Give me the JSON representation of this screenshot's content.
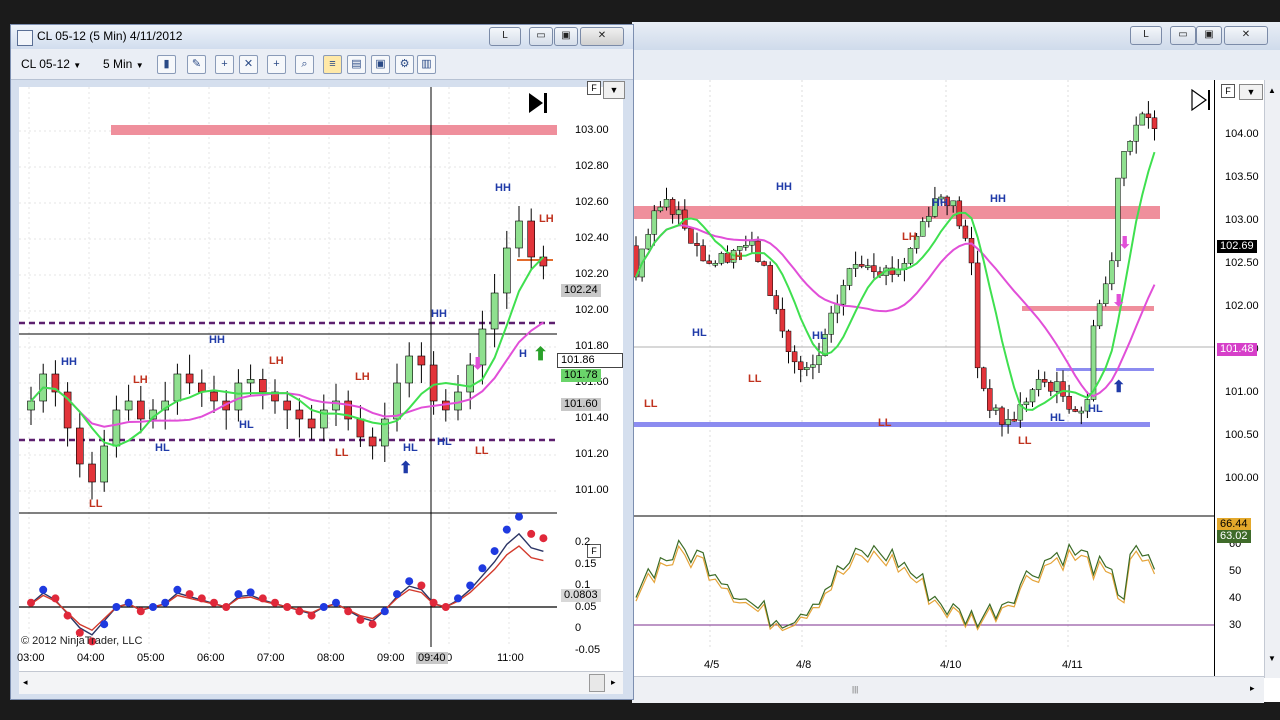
{
  "front_window": {
    "title": "CL 05-12 (5 Min)  4/11/2012",
    "toolbar": {
      "instrument": "CL 05-12",
      "interval": "5 Min"
    },
    "price_axis": [
      "103.00",
      "102.80",
      "102.60",
      "102.40",
      "102.20",
      "102.00",
      "101.80",
      "101.60",
      "101.40",
      "101.20",
      "101.00"
    ],
    "price_tags": {
      "last": "102.24",
      "line": "101.86",
      "green": "101.78",
      "grey": "101.60"
    },
    "indicator_axis": [
      "0.2",
      "0.15",
      "0.1",
      "0.05",
      "0",
      "-0.05"
    ],
    "indicator_value": "0.0803",
    "time_axis": [
      "03:00",
      "04:00",
      "05:00",
      "06:00",
      "07:00",
      "08:00",
      "09:00",
      ":00",
      "11:00"
    ],
    "cursor_time": "09:40",
    "copyright": "© 2012 NinjaTrader, LLC",
    "panel_button": "F",
    "swing_labels": [
      {
        "text": "HH",
        "color": "blue"
      },
      {
        "text": "LH",
        "color": "red"
      },
      {
        "text": "HH",
        "color": "blue"
      },
      {
        "text": "LH",
        "color": "red"
      },
      {
        "text": "LH",
        "color": "red"
      },
      {
        "text": "HH",
        "color": "blue"
      },
      {
        "text": "HH",
        "color": "blue"
      },
      {
        "text": "LH",
        "color": "red"
      },
      {
        "text": "HL",
        "color": "blue"
      },
      {
        "text": "HL",
        "color": "blue"
      },
      {
        "text": "HL",
        "color": "blue"
      },
      {
        "text": "LL",
        "color": "red"
      },
      {
        "text": "LL",
        "color": "red"
      },
      {
        "text": "LL",
        "color": "red"
      },
      {
        "text": "HL",
        "color": "blue"
      },
      {
        "text": "H",
        "color": "blue"
      }
    ]
  },
  "back_window": {
    "price_axis": [
      "104.00",
      "103.50",
      "103.00",
      "102.50",
      "102.00",
      "101.50",
      "101.00",
      "100.50",
      "100.00"
    ],
    "price_tags": {
      "last": "102.69",
      "ma": "101.48"
    },
    "indicator_axis": [
      "60",
      "50",
      "40",
      "30"
    ],
    "indicator_tags": {
      "a": "66.44",
      "b": "63.02"
    },
    "date_axis": [
      "4/5",
      "4/8",
      "4/10",
      "4/11"
    ],
    "panel_button": "F",
    "swing_labels": [
      {
        "text": "HH",
        "color": "blue"
      },
      {
        "text": "HH",
        "color": "blue"
      },
      {
        "text": "HH",
        "color": "blue"
      },
      {
        "text": "LH",
        "color": "red"
      },
      {
        "text": "LH",
        "color": "red"
      },
      {
        "text": "HL",
        "color": "blue"
      },
      {
        "text": "HL",
        "color": "blue"
      },
      {
        "text": "HL",
        "color": "blue"
      },
      {
        "text": "HL",
        "color": "blue"
      },
      {
        "text": "LL",
        "color": "red"
      },
      {
        "text": "LL",
        "color": "red"
      },
      {
        "text": "LL",
        "color": "red"
      },
      {
        "text": "LL",
        "color": "red"
      }
    ]
  },
  "window_buttons": {
    "restore": "L",
    "minimize": "▭",
    "maximize": "▣",
    "close": "✕"
  },
  "colors": {
    "bull": "#8fe08f",
    "bear": "#e2343a",
    "resistance": "#ef8f9c",
    "support": "#8c8cf0",
    "ma_fast": "#3fe04f",
    "ma_slow": "#e14fd8",
    "dashed": "#5c1f6e"
  }
}
